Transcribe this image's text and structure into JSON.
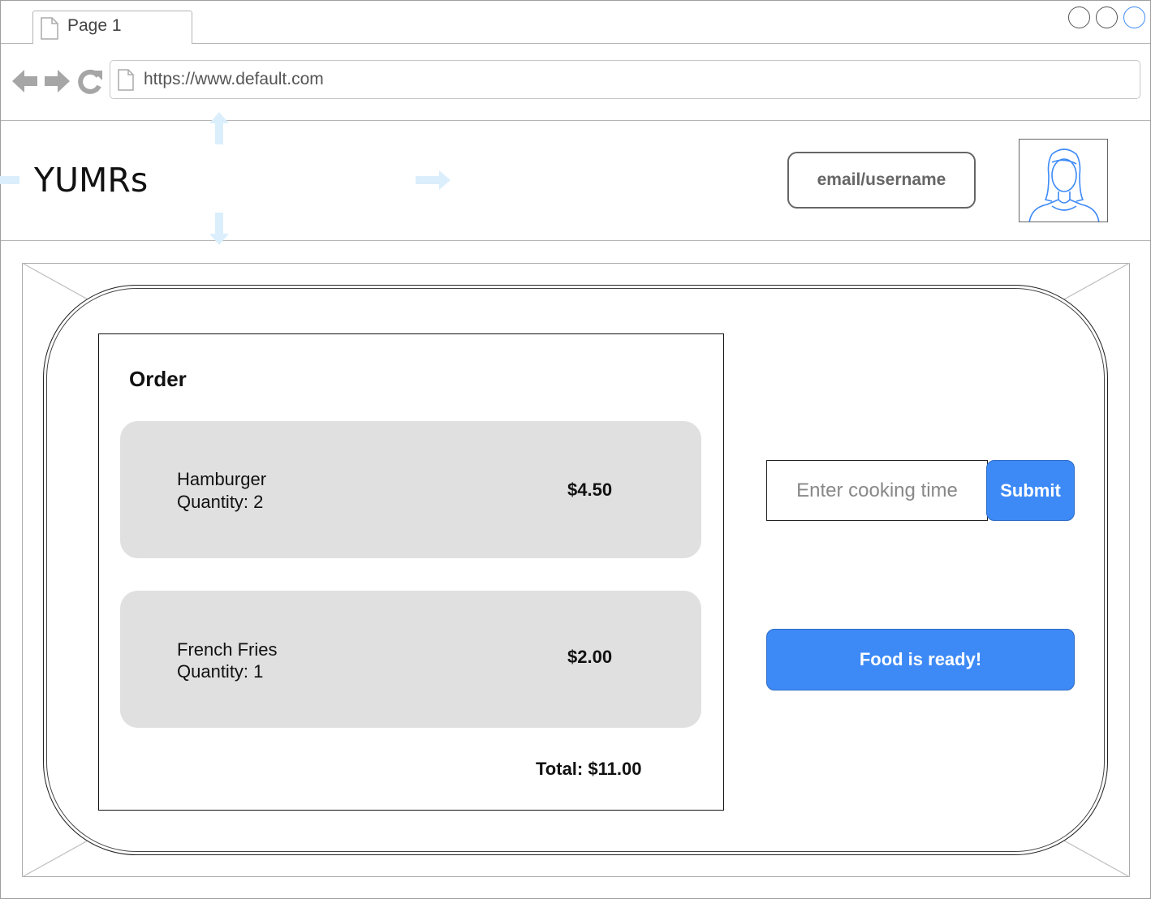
{
  "browser": {
    "tab_label": "Page 1",
    "url": "https://www.default.com"
  },
  "header": {
    "brand": "YUMRs",
    "login_label": "email/username"
  },
  "order": {
    "title": "Order",
    "items": [
      {
        "name": "Hamburger",
        "quantity": "Quantity: 2",
        "price": "$4.50"
      },
      {
        "name": "French Fries",
        "quantity": "Quantity: 1",
        "price": "$2.00"
      }
    ],
    "total": "Total: $11.00"
  },
  "cooking": {
    "placeholder": "Enter cooking time",
    "submit_label": "Submit"
  },
  "ready_label": "Food is ready!",
  "colors": {
    "accent": "#3d8af7",
    "card_bg": "#e0e0e0",
    "guide": "#dbeefc"
  }
}
